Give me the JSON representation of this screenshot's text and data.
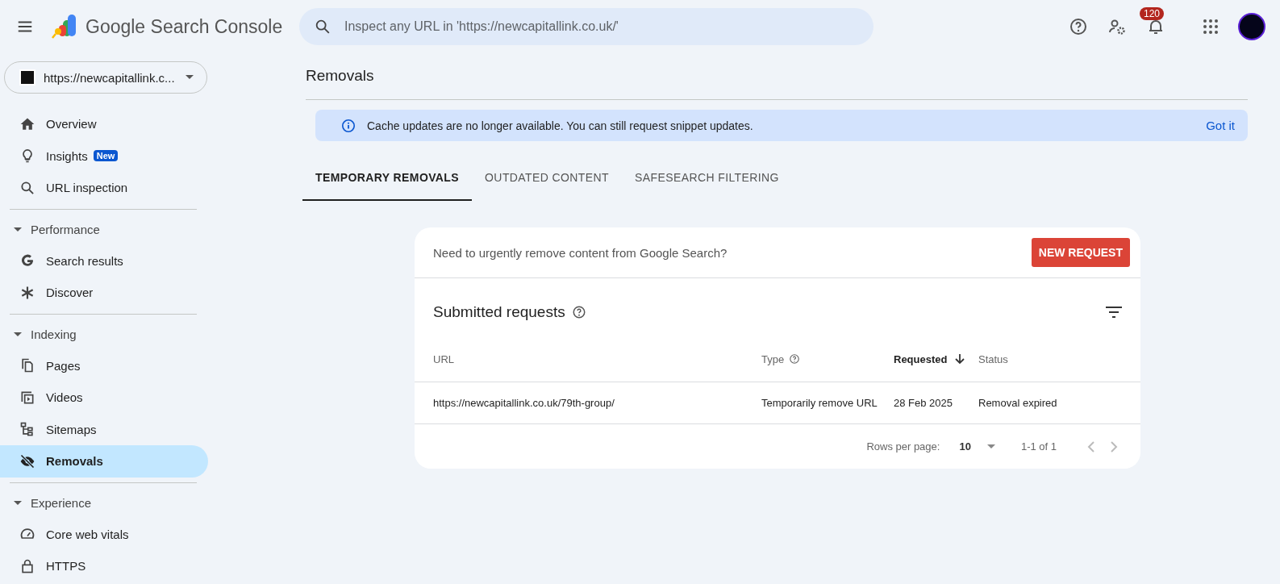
{
  "app": {
    "title_google": "Google",
    "title_product": "Search Console"
  },
  "search": {
    "placeholder": "Inspect any URL in 'https://newcapitallink.co.uk/'"
  },
  "notifications": {
    "count": "120"
  },
  "property": {
    "value": "https://newcapitallink.c..."
  },
  "sidebar": {
    "groups": [
      {
        "items": [
          {
            "label": "Overview",
            "selected": false
          },
          {
            "label": "Insights",
            "badge": "New",
            "selected": false
          },
          {
            "label": "URL inspection",
            "selected": false
          }
        ]
      },
      {
        "heading": "Performance",
        "expanded": true,
        "items": [
          {
            "label": "Search results",
            "selected": false
          },
          {
            "label": "Discover",
            "selected": false
          }
        ]
      },
      {
        "heading": "Indexing",
        "expanded": true,
        "items": [
          {
            "label": "Pages",
            "selected": false
          },
          {
            "label": "Videos",
            "selected": false
          },
          {
            "label": "Sitemaps",
            "selected": false
          },
          {
            "label": "Removals",
            "selected": true
          }
        ]
      },
      {
        "heading": "Experience",
        "expanded": true,
        "items": [
          {
            "label": "Core web vitals",
            "selected": false
          },
          {
            "label": "HTTPS",
            "selected": false
          }
        ]
      }
    ]
  },
  "page": {
    "title": "Removals"
  },
  "banner": {
    "text": "Cache updates are no longer available. You can still request snippet updates.",
    "action": "Got it"
  },
  "tabs": [
    {
      "label": "TEMPORARY REMOVALS",
      "selected": true
    },
    {
      "label": "OUTDATED CONTENT",
      "selected": false
    },
    {
      "label": "SAFESEARCH FILTERING",
      "selected": false
    }
  ],
  "card": {
    "prompt": "Need to urgently remove content from Google Search?",
    "button": "NEW REQUEST",
    "title": "Submitted requests",
    "table": {
      "columns": [
        {
          "label": "URL",
          "help": false,
          "sorted": false
        },
        {
          "label": "Type",
          "help": true,
          "sorted": false
        },
        {
          "label": "Requested",
          "help": false,
          "sorted": true
        },
        {
          "label": "Status",
          "help": false,
          "sorted": false
        }
      ],
      "rows": [
        [
          "https://newcapitallink.co.uk/79th-group/",
          "Temporarily remove URL",
          "28 Feb 2025",
          "Removal expired"
        ]
      ]
    },
    "pagination": {
      "rows_label": "Rows per page:",
      "rows_value": "10",
      "range": "1-1 of 1"
    }
  }
}
